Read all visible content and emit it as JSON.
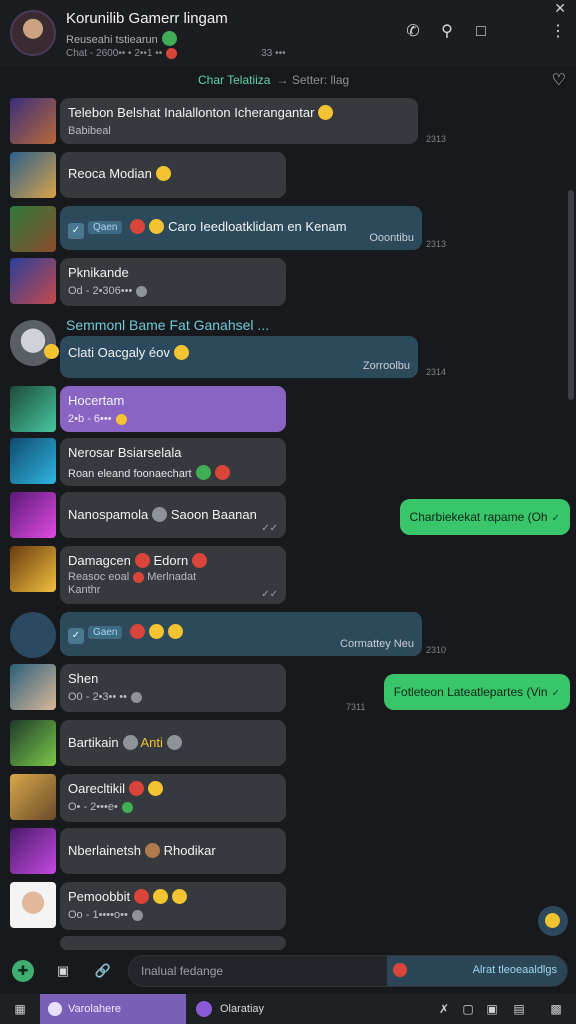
{
  "header": {
    "title": "Korunilib Gamerr lingam",
    "subtitle": "Reuseahi tstiearun",
    "meta_left": "Chat - 2600•• • 2••1 ••",
    "meta_right": "33 •••",
    "icons": [
      "phone-icon",
      "search-icon",
      "square-icon",
      "more-icon"
    ]
  },
  "chat_label": {
    "left": "Char Telatiiza",
    "right": "→ Setter: llag"
  },
  "rows": [
    {
      "text": "Telebon Belshat Inalallonton Icherangantar",
      "sub": "Babibeal",
      "time": "2313"
    },
    {
      "text": "Reoca Modian"
    },
    {
      "tag": "Qaen",
      "text": "Caro Ieedloatklidam en Kenam",
      "corner": "Ooontibu",
      "time": "2313"
    },
    {
      "text": "Pknikande",
      "sub": "Od - 2•306•••"
    },
    {
      "text": "Clati Oacgaly éov",
      "corner": "Zorroolbu",
      "time": "2314"
    },
    {
      "text": "Hocertam",
      "sub": "2•b - 6•••"
    },
    {
      "text": "Nerosar Bsiarselala",
      "sub": "Roan eleand foonaechart"
    },
    {
      "text": "Nanospamola",
      "text2": "Saoon Baanan",
      "sent": "Charbiekekat rapame (Oh"
    },
    {
      "text": "Damagcen",
      "text2": "Edorn",
      "sub": "Reasoc eoal",
      "sub2": "Merlnadat",
      "sub3": "Kanthr"
    },
    {
      "tag": "Gaen",
      "corner": "Cormattey Neu",
      "time": "2310"
    },
    {
      "text": "Shen",
      "sub": "O0 - 2•3•• ••",
      "sent": "Fotleteon Lateatlepartes (Vin",
      "sent_time": "7311"
    },
    {
      "text": "Bartikain",
      "text2": "Anti"
    },
    {
      "text": "Oarecltikil",
      "sub": "O• - 2•••e•"
    },
    {
      "text": "Nberlainetsh",
      "text2": "Rhodikar"
    },
    {
      "text": "Pemoobbit",
      "sub": "Oo - 1••••o••"
    }
  ],
  "section_title": "Semmonl Bame Fat Ganahsel ...",
  "input": {
    "placeholder": "Inalual fedange",
    "right_label": "Alrat tleoeaaldlgs"
  },
  "taskbar": {
    "active_label": "Varolahere",
    "second_label": "Olaratiay"
  }
}
